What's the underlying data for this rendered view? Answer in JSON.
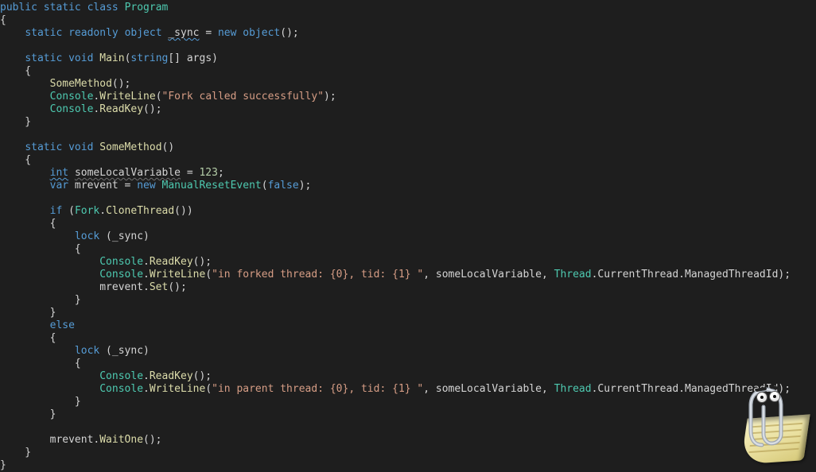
{
  "code": {
    "tokens": [
      [
        {
          "t": "public",
          "c": "kw"
        },
        {
          "t": " "
        },
        {
          "t": "static",
          "c": "kw"
        },
        {
          "t": " "
        },
        {
          "t": "class",
          "c": "kw"
        },
        {
          "t": " "
        },
        {
          "t": "Program",
          "c": "type"
        }
      ],
      [
        {
          "t": "{",
          "c": "punct"
        }
      ],
      [
        {
          "t": "    "
        },
        {
          "t": "static",
          "c": "kw"
        },
        {
          "t": " "
        },
        {
          "t": "readonly",
          "c": "kw"
        },
        {
          "t": " "
        },
        {
          "t": "object",
          "c": "kw"
        },
        {
          "t": " "
        },
        {
          "t": "_sync",
          "c": "punct wavy-blue"
        },
        {
          "t": " = ",
          "c": "punct"
        },
        {
          "t": "new",
          "c": "kw"
        },
        {
          "t": " "
        },
        {
          "t": "object",
          "c": "kw"
        },
        {
          "t": "();",
          "c": "punct"
        }
      ],
      [],
      [
        {
          "t": "    "
        },
        {
          "t": "static",
          "c": "kw"
        },
        {
          "t": " "
        },
        {
          "t": "void",
          "c": "kw"
        },
        {
          "t": " "
        },
        {
          "t": "Main",
          "c": "id"
        },
        {
          "t": "(",
          "c": "punct"
        },
        {
          "t": "string",
          "c": "kw"
        },
        {
          "t": "[] args)",
          "c": "punct"
        }
      ],
      [
        {
          "t": "    {",
          "c": "punct"
        }
      ],
      [
        {
          "t": "        "
        },
        {
          "t": "SomeMethod",
          "c": "id"
        },
        {
          "t": "();",
          "c": "punct"
        }
      ],
      [
        {
          "t": "        "
        },
        {
          "t": "Console",
          "c": "type"
        },
        {
          "t": ".",
          "c": "punct"
        },
        {
          "t": "WriteLine",
          "c": "id"
        },
        {
          "t": "(",
          "c": "punct"
        },
        {
          "t": "\"Fork called successfully\"",
          "c": "str"
        },
        {
          "t": ");",
          "c": "punct"
        }
      ],
      [
        {
          "t": "        "
        },
        {
          "t": "Console",
          "c": "type"
        },
        {
          "t": ".",
          "c": "punct"
        },
        {
          "t": "ReadKey",
          "c": "id"
        },
        {
          "t": "();",
          "c": "punct"
        }
      ],
      [
        {
          "t": "    }",
          "c": "punct"
        }
      ],
      [],
      [
        {
          "t": "    "
        },
        {
          "t": "static",
          "c": "kw"
        },
        {
          "t": " "
        },
        {
          "t": "void",
          "c": "kw"
        },
        {
          "t": " "
        },
        {
          "t": "SomeMethod",
          "c": "id"
        },
        {
          "t": "()",
          "c": "punct"
        }
      ],
      [
        {
          "t": "    {",
          "c": "punct"
        }
      ],
      [
        {
          "t": "        "
        },
        {
          "t": "int",
          "c": "kw wavy-blue"
        },
        {
          "t": " "
        },
        {
          "t": "someLocalVariable",
          "c": "punct wavy-grey"
        },
        {
          "t": " = ",
          "c": "punct"
        },
        {
          "t": "123",
          "c": "num"
        },
        {
          "t": ";",
          "c": "punct"
        }
      ],
      [
        {
          "t": "        "
        },
        {
          "t": "var",
          "c": "kw"
        },
        {
          "t": " mrevent = ",
          "c": "punct"
        },
        {
          "t": "new",
          "c": "kw"
        },
        {
          "t": " "
        },
        {
          "t": "ManualResetEvent",
          "c": "type"
        },
        {
          "t": "(",
          "c": "punct"
        },
        {
          "t": "false",
          "c": "kw"
        },
        {
          "t": ");",
          "c": "punct"
        }
      ],
      [],
      [
        {
          "t": "        "
        },
        {
          "t": "if",
          "c": "kw"
        },
        {
          "t": " (",
          "c": "punct"
        },
        {
          "t": "Fork",
          "c": "type"
        },
        {
          "t": ".",
          "c": "punct"
        },
        {
          "t": "CloneThread",
          "c": "id"
        },
        {
          "t": "())",
          "c": "punct"
        }
      ],
      [
        {
          "t": "        {",
          "c": "punct"
        }
      ],
      [
        {
          "t": "            "
        },
        {
          "t": "lock",
          "c": "kw"
        },
        {
          "t": " (_sync)",
          "c": "punct"
        }
      ],
      [
        {
          "t": "            {",
          "c": "punct"
        }
      ],
      [
        {
          "t": "                "
        },
        {
          "t": "Console",
          "c": "type"
        },
        {
          "t": ".",
          "c": "punct"
        },
        {
          "t": "ReadKey",
          "c": "id"
        },
        {
          "t": "();",
          "c": "punct"
        }
      ],
      [
        {
          "t": "                "
        },
        {
          "t": "Console",
          "c": "type"
        },
        {
          "t": ".",
          "c": "punct"
        },
        {
          "t": "WriteLine",
          "c": "id"
        },
        {
          "t": "(",
          "c": "punct"
        },
        {
          "t": "\"in forked thread: {0}, tid: {1} \"",
          "c": "str"
        },
        {
          "t": ", someLocalVariable, ",
          "c": "punct"
        },
        {
          "t": "Thread",
          "c": "type"
        },
        {
          "t": ".CurrentThread.ManagedThreadId);",
          "c": "punct"
        }
      ],
      [
        {
          "t": "                mrevent.",
          "c": "punct"
        },
        {
          "t": "Set",
          "c": "id"
        },
        {
          "t": "();",
          "c": "punct"
        }
      ],
      [
        {
          "t": "            }",
          "c": "punct"
        }
      ],
      [
        {
          "t": "        }",
          "c": "punct"
        }
      ],
      [
        {
          "t": "        "
        },
        {
          "t": "else",
          "c": "kw"
        }
      ],
      [
        {
          "t": "        {",
          "c": "punct"
        }
      ],
      [
        {
          "t": "            "
        },
        {
          "t": "lock",
          "c": "kw"
        },
        {
          "t": " (_sync)",
          "c": "punct"
        }
      ],
      [
        {
          "t": "            {",
          "c": "punct"
        }
      ],
      [
        {
          "t": "                "
        },
        {
          "t": "Console",
          "c": "type"
        },
        {
          "t": ".",
          "c": "punct"
        },
        {
          "t": "ReadKey",
          "c": "id"
        },
        {
          "t": "();",
          "c": "punct"
        }
      ],
      [
        {
          "t": "                "
        },
        {
          "t": "Console",
          "c": "type"
        },
        {
          "t": ".",
          "c": "punct"
        },
        {
          "t": "WriteLine",
          "c": "id"
        },
        {
          "t": "(",
          "c": "punct"
        },
        {
          "t": "\"in parent thread: {0}, tid: {1} \"",
          "c": "str"
        },
        {
          "t": ", someLocalVariable, ",
          "c": "punct"
        },
        {
          "t": "Thread",
          "c": "type"
        },
        {
          "t": ".CurrentThread.ManagedThreadId);",
          "c": "punct"
        }
      ],
      [
        {
          "t": "            }",
          "c": "punct"
        }
      ],
      [
        {
          "t": "        }",
          "c": "punct"
        }
      ],
      [],
      [
        {
          "t": "        mrevent.",
          "c": "punct"
        },
        {
          "t": "WaitOne",
          "c": "id"
        },
        {
          "t": "();",
          "c": "punct"
        }
      ],
      [
        {
          "t": "    }",
          "c": "punct"
        }
      ],
      [
        {
          "t": "}",
          "c": "punct"
        }
      ]
    ]
  },
  "assistant": {
    "name": "clippy-office-assistant"
  }
}
